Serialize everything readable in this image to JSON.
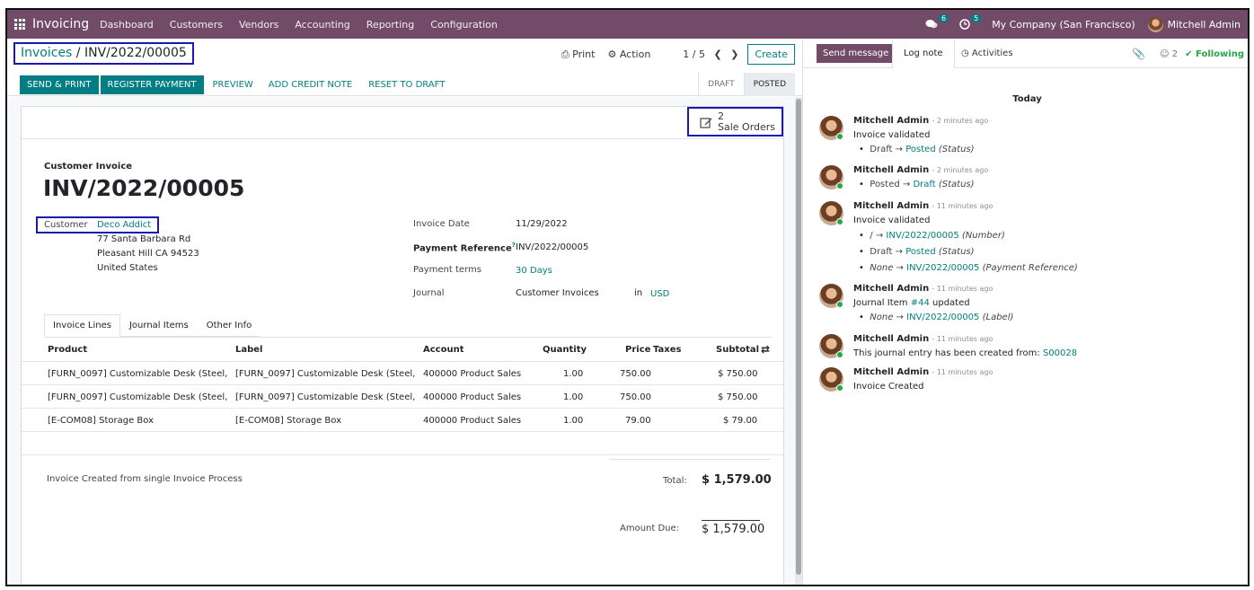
{
  "navbar": {
    "app_name": "Invoicing",
    "menus": [
      "Dashboard",
      "Customers",
      "Vendors",
      "Accounting",
      "Reporting",
      "Configuration"
    ],
    "messages_count": "6",
    "activities_count": "5",
    "company": "My Company (San Francisco)",
    "user": "Mitchell Admin"
  },
  "control_panel": {
    "breadcrumb_parent": "Invoices",
    "breadcrumb_sep": " / ",
    "breadcrumb_current": "INV/2022/00005",
    "print_label": "Print",
    "action_label": "Action",
    "pager": "1 / 5",
    "create_label": "Create"
  },
  "statusbar": {
    "send_print": "SEND & PRINT",
    "register_payment": "REGISTER PAYMENT",
    "preview": "PREVIEW",
    "add_credit_note": "ADD CREDIT NOTE",
    "reset_to_draft": "RESET TO DRAFT",
    "steps": [
      "DRAFT",
      "POSTED"
    ],
    "active_step": "POSTED"
  },
  "smart_button": {
    "count": "2",
    "label": "Sale Orders"
  },
  "invoice": {
    "type_label": "Customer Invoice",
    "name": "INV/2022/00005",
    "customer_label": "Customer",
    "customer": "Deco Addict",
    "address_line1": "77 Santa Barbara Rd",
    "address_line2": "Pleasant Hill CA 94523",
    "address_line3": "United States",
    "invoice_date_label": "Invoice Date",
    "invoice_date": "11/29/2022",
    "payment_ref_label": "Payment Reference",
    "payment_ref_help": "?",
    "payment_ref": "INV/2022/00005",
    "payment_terms_label": "Payment terms",
    "payment_terms": "30 Days",
    "journal_label": "Journal",
    "journal": "Customer Invoices",
    "journal_in": "in",
    "currency": "USD"
  },
  "tabs": [
    "Invoice Lines",
    "Journal Items",
    "Other Info"
  ],
  "lines_table": {
    "headers": [
      "Product",
      "Label",
      "Account",
      "Quantity",
      "Price",
      "Taxes",
      "Subtotal"
    ],
    "rows": [
      [
        "[FURN_0097] Customizable Desk (Steel, ...",
        "[FURN_0097] Customizable Desk (Steel, ...",
        "400000 Product Sales",
        "1.00",
        "750.00",
        "",
        "$ 750.00"
      ],
      [
        "[FURN_0097] Customizable Desk (Steel, ...",
        "[FURN_0097] Customizable Desk (Steel, ...",
        "400000 Product Sales",
        "1.00",
        "750.00",
        "",
        "$ 750.00"
      ],
      [
        "[E-COM08] Storage Box",
        "[E-COM08] Storage Box",
        "400000 Product Sales",
        "1.00",
        "79.00",
        "",
        "$ 79.00"
      ]
    ]
  },
  "totals": {
    "narration": "Invoice Created from single Invoice Process",
    "total_label": "Total:",
    "total": "$ 1,579.00",
    "amount_due_label": "Amount Due:",
    "amount_due": "$ 1,579.00"
  },
  "chatter": {
    "send_message": "Send message",
    "log_note": "Log note",
    "activities": "Activities",
    "followers_count": "2",
    "following": "Following",
    "today": "Today",
    "messages": [
      {
        "author": "Mitchell Admin",
        "ago": "- 2 minutes ago",
        "body": "Invoice validated",
        "tracking": [
          {
            "old": "Draft",
            "new": "Posted",
            "field": "(Status)"
          }
        ]
      },
      {
        "author": "Mitchell Admin",
        "ago": "- 2 minutes ago",
        "body": "",
        "tracking": [
          {
            "old": "Posted",
            "new": "Draft",
            "field": "(Status)"
          }
        ]
      },
      {
        "author": "Mitchell Admin",
        "ago": "- 11 minutes ago",
        "body": "Invoice validated",
        "tracking": [
          {
            "old": "/",
            "new": "INV/2022/00005",
            "field": "(Number)"
          },
          {
            "old": "Draft",
            "new": "Posted",
            "field": "(Status)"
          },
          {
            "old": "None",
            "new": "INV/2022/00005",
            "field": "(Payment Reference)"
          }
        ]
      },
      {
        "author": "Mitchell Admin",
        "ago": "- 11 minutes ago",
        "body_prefix": "Journal Item ",
        "body_link": "#44",
        "body_suffix": " updated",
        "tracking": [
          {
            "old": "None",
            "new": "INV/2022/00005",
            "field": "(Label)"
          }
        ]
      },
      {
        "author": "Mitchell Admin",
        "ago": "- 11 minutes ago",
        "body_prefix": "This journal entry has been created from: ",
        "body_link": "S00028",
        "body_suffix": "",
        "tracking": []
      },
      {
        "author": "Mitchell Admin",
        "ago": "- 11 minutes ago",
        "body": "Invoice Created",
        "tracking": []
      }
    ]
  },
  "colors": {
    "brand": "#714B67",
    "accent": "#017e84",
    "highlight_box": "#1a1ab0",
    "following": "#28a745"
  }
}
